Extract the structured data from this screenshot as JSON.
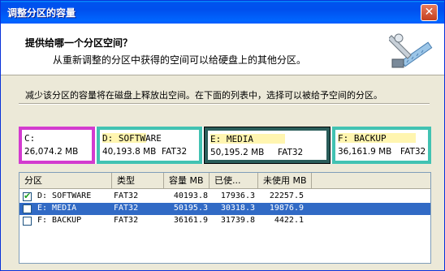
{
  "window": {
    "title": "调整分区的容量",
    "close_glyph": "✕"
  },
  "header": {
    "title": "提供给哪一个分区空间？",
    "subtitle": "从重新调整的分区中获得的空间可以给硬盘上的其他分区。"
  },
  "description": "减少该分区的容量将在磁盘上释放出空间。在下面的列表中，选择可以被给予空间的分区。",
  "colors": {
    "selected_border": "#d33bcf",
    "teal": "#41c2b2",
    "selected_row": "#316ac5"
  },
  "partition_bar": [
    {
      "label": "C:",
      "size": "26,074.2 MB",
      "fs": ""
    },
    {
      "label": "D: SOFTWARE",
      "size": "40,193.8 MB",
      "fs": "FAT32"
    },
    {
      "label": "E: MEDIA",
      "size": "50,195.2 MB",
      "fs": "FAT32"
    },
    {
      "label": "F: BACKUP",
      "size": "36,161.9 MB",
      "fs": "FAT32"
    }
  ],
  "list": {
    "columns": [
      "分区",
      "类型",
      "容量 MB",
      "已使...",
      "未使用 MB"
    ],
    "rows": [
      {
        "checked": true,
        "selected": false,
        "partition": "D: SOFTWARE",
        "type": "FAT32",
        "capacity": "40193.8",
        "used": "17936.3",
        "unused": "22257.5"
      },
      {
        "checked": false,
        "selected": true,
        "partition": "E: MEDIA",
        "type": "FAT32",
        "capacity": "50195.3",
        "used": "30318.3",
        "unused": "19876.9"
      },
      {
        "checked": false,
        "selected": false,
        "partition": "F: BACKUP",
        "type": "FAT32",
        "capacity": "36161.9",
        "used": "31739.8",
        "unused": "4422.1"
      }
    ]
  }
}
